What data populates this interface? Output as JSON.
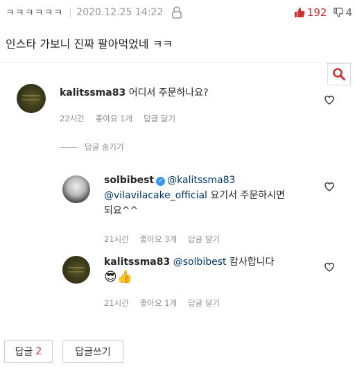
{
  "post": {
    "nickname": "ㅋㅋㅋㅋㅋㅋ",
    "date": "2020.12.25 14:22",
    "upvotes": "192",
    "downvotes": "4",
    "text": "인스타 가보니 진짜 팔아먹었네 ㅋㅋ"
  },
  "screenshot": {
    "comments": [
      {
        "user": "kalitssma83",
        "text": "어디서 주문하나요?",
        "time": "22시간",
        "likes": "좋아요 1개",
        "reply": "답글 달기"
      }
    ],
    "hide_replies": "답글 숨기기",
    "replies": [
      {
        "user": "solbibest",
        "mention1": "@kalitssma83",
        "mention2": "@vilavilacake_official",
        "text1": "요기서 주문하시면",
        "text2": "되요^^",
        "time": "21시간",
        "likes": "좋아요 3개",
        "reply": "답글 달기"
      },
      {
        "user": "kalitssma83",
        "mention": "@solbibest",
        "text": "캄사합니다",
        "emojis": "😎👍",
        "time": "21시간",
        "likes": "좋아요 1개",
        "reply": "답글 달기"
      }
    ]
  },
  "buttons": {
    "reply_label": "답글",
    "reply_count": "2",
    "write_reply": "답글쓰기"
  },
  "colors": {
    "upvote": "#d0312d",
    "mention": "#00376b",
    "search_icon": "#d0312d"
  }
}
